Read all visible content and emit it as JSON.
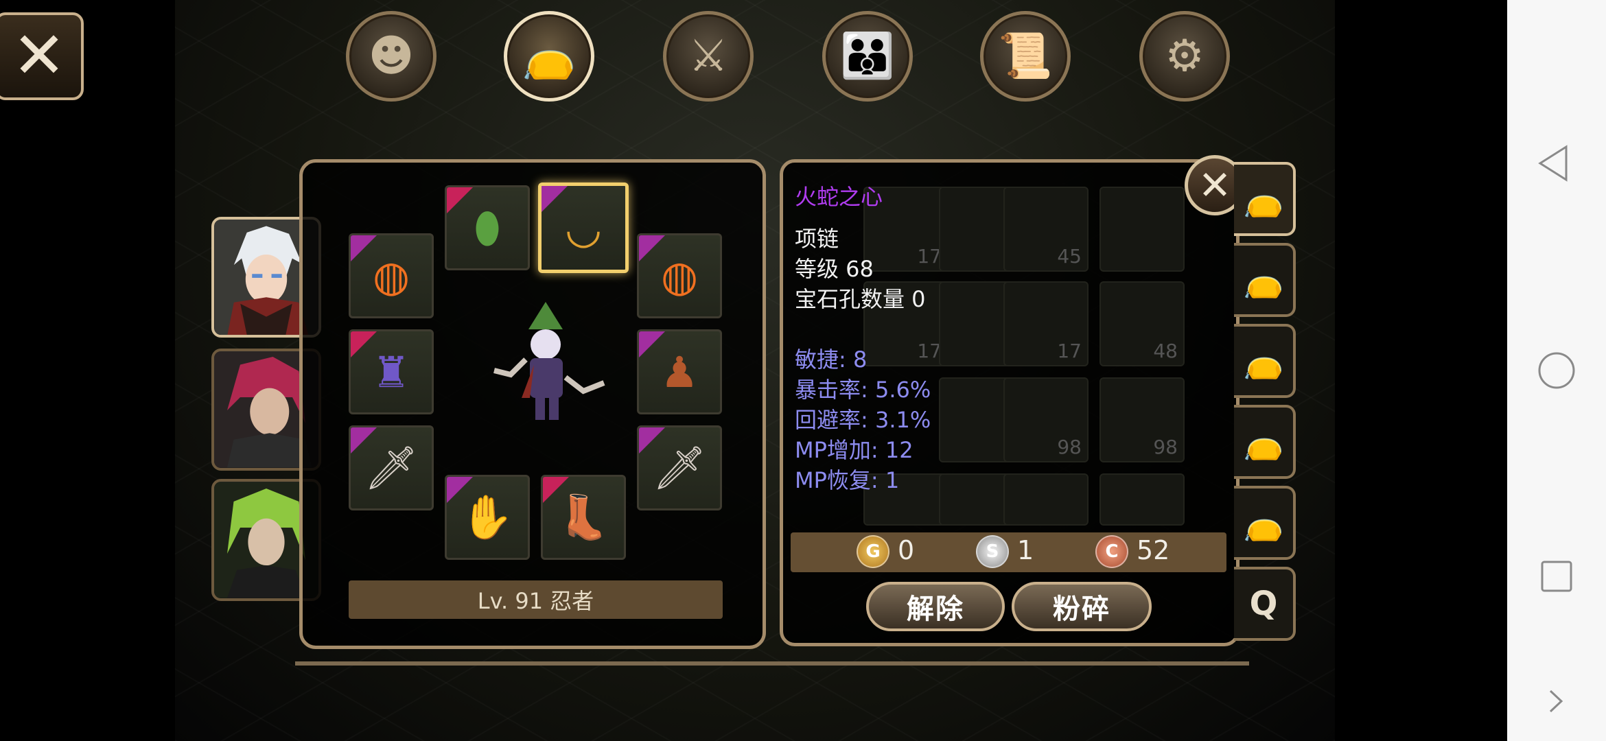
{
  "top_menu": {
    "items": [
      {
        "name": "character",
        "icon": "head-silhouette-icon"
      },
      {
        "name": "inventory",
        "icon": "bag-icon",
        "active": true
      },
      {
        "name": "skills",
        "icon": "crossed-sword-icon"
      },
      {
        "name": "party",
        "icon": "people-icon"
      },
      {
        "name": "quest",
        "icon": "scroll-icon"
      },
      {
        "name": "settings",
        "icon": "gear-icon"
      }
    ]
  },
  "equipment": {
    "level_label": "Lv. 91 忍者"
  },
  "item_info": {
    "name": "火蛇之心",
    "name_color": "#b03cf0",
    "type": "项链",
    "level": "等级 68",
    "sockets": "宝石孔数量 0",
    "stats": [
      "敏捷: 8",
      "暴击率: 5.6%",
      "回避率: 3.1%",
      "MP增加: 12",
      "MP恢复: 1"
    ]
  },
  "inventory": {
    "counts": [
      "17",
      "45",
      "17",
      "17",
      "48",
      "98",
      "98"
    ]
  },
  "currency": {
    "gold": {
      "symbol": "G",
      "value": "0"
    },
    "silver": {
      "symbol": "S",
      "value": "1"
    },
    "copper": {
      "symbol": "C",
      "value": "52"
    }
  },
  "actions": {
    "unequip": "解除",
    "smash": "粉碎"
  },
  "bag_tabs": {
    "last_label": "Q"
  },
  "colors": {
    "accent_border": "#a58c6a",
    "stat_text": "#8d8cf0",
    "epic_marker": "#a22ea0",
    "rare_marker": "#c8225a"
  }
}
